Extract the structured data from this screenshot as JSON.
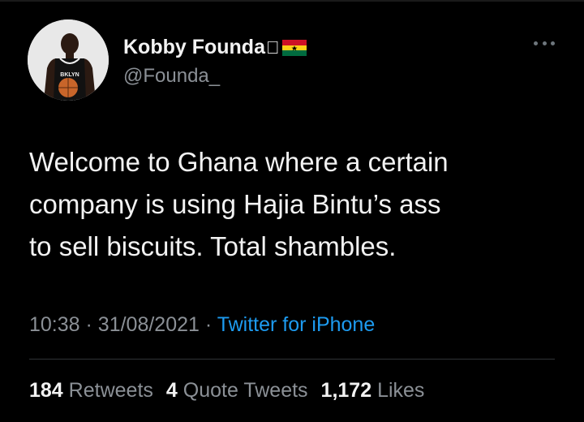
{
  "tweet": {
    "author": {
      "display_name": "Kobby Founda",
      "handle": "@Founda_",
      "name_emoji": [
        "apple-icon",
        "ghana-flag-icon"
      ]
    },
    "text_lines": [
      "Welcome to Ghana where a certain",
      "company is using Hajia Bintu’s ass",
      "to sell biscuits. Total shambles."
    ],
    "time": "10:38",
    "date": "31/08/2021",
    "separator": "·",
    "source": "Twitter for iPhone",
    "stats": {
      "retweets_count": "184",
      "retweets_label": "Retweets",
      "quotes_count": "4",
      "quotes_label": "Quote Tweets",
      "likes_count": "1,172",
      "likes_label": "Likes"
    }
  },
  "colors": {
    "background": "#000000",
    "text": "#f2f2f2",
    "muted": "#8b9096",
    "link": "#1d9bf0",
    "divider": "#2f3336"
  }
}
